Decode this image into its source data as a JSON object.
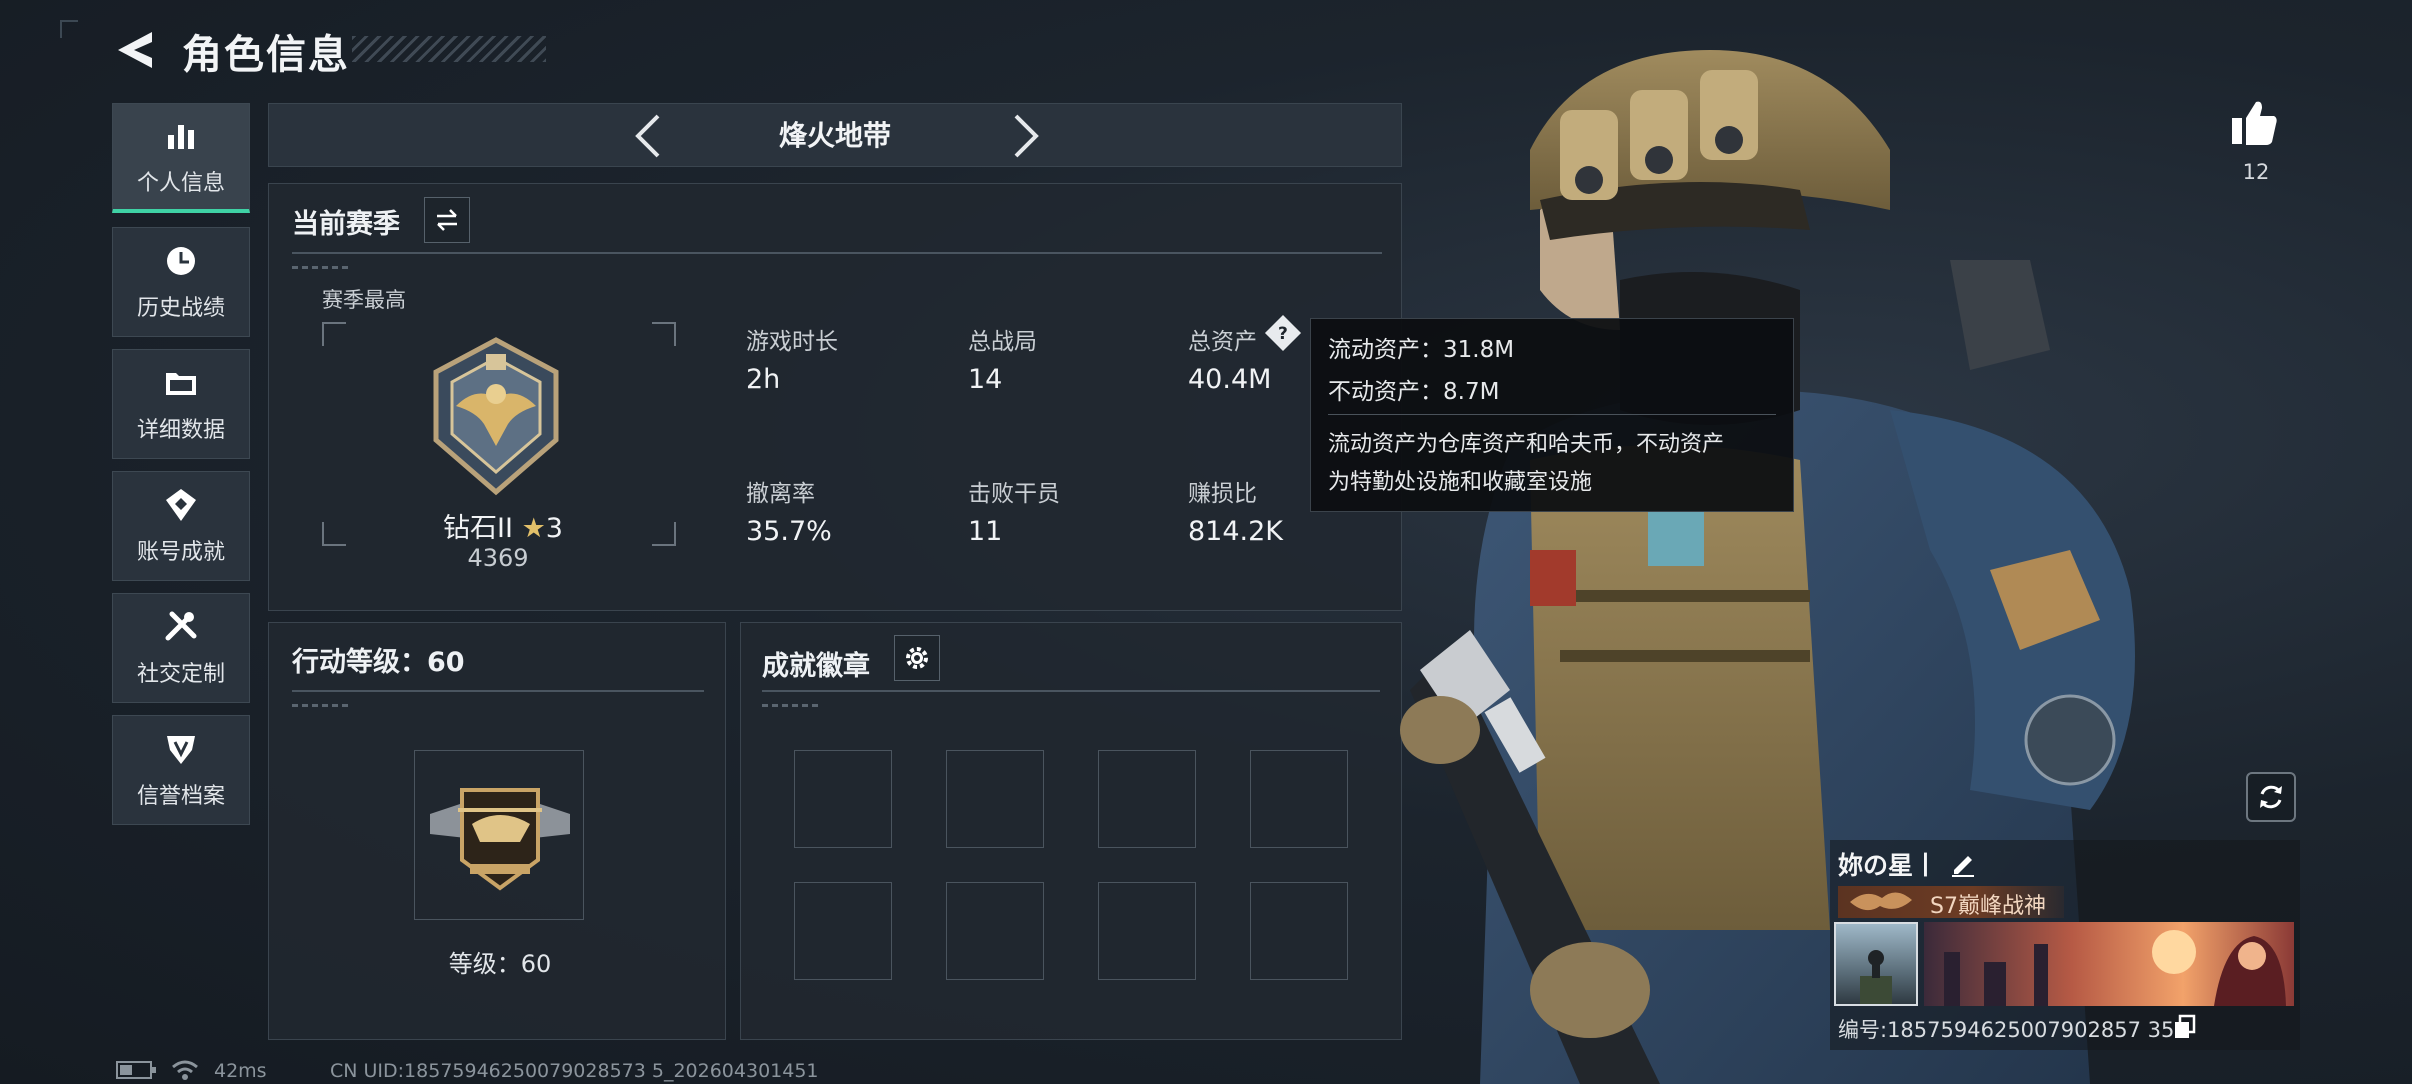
{
  "header": {
    "title": "角色信息"
  },
  "sidebar": {
    "items": [
      {
        "label": "个人信息",
        "icon": "bar-chart-icon",
        "active": true
      },
      {
        "label": "历史战绩",
        "icon": "history-icon"
      },
      {
        "label": "详细数据",
        "icon": "folder-icon"
      },
      {
        "label": "账号成就",
        "icon": "achievement-icon"
      },
      {
        "label": "社交定制",
        "icon": "tools-icon"
      },
      {
        "label": "信誉档案",
        "icon": "credit-icon"
      }
    ]
  },
  "mode": {
    "title": "烽火地带"
  },
  "season": {
    "title": "当前赛季",
    "best_label": "赛季最高",
    "rank": "钻石II",
    "rank_stars": "3",
    "rank_score": "4369",
    "stats": [
      {
        "label": "游戏时长",
        "value": "2h"
      },
      {
        "label": "总战局",
        "value": "14"
      },
      {
        "label": "总资产",
        "value": "40.4M"
      },
      {
        "label": "撤离率",
        "value": "35.7%"
      },
      {
        "label": "击败干员",
        "value": "11"
      },
      {
        "label": "赚损比",
        "value": "814.2K"
      }
    ]
  },
  "tooltip": {
    "liquid": "流动资产：31.8M",
    "fixed": "不动资产：8.7M",
    "note_line1": "流动资产为仓库资产和哈夫币，不动资产",
    "note_line2": "为特勤处设施和收藏室设施"
  },
  "action_level": {
    "title": "行动等级：60",
    "level_label": "等级：60"
  },
  "achievements": {
    "title": "成就徽章",
    "slot_count": 8
  },
  "profile": {
    "like_count": "12",
    "player_name": "妳の星丨",
    "player_title": "S7巅峰战神",
    "player_id": "编号:1857594625007902857 35"
  },
  "status": {
    "ping": "42ms",
    "uid": "CN UID:18575946250079028573 5_202604301451"
  },
  "colors": {
    "accent": "#3fd2a5",
    "panel": "#212830",
    "background": "#1c242d"
  }
}
